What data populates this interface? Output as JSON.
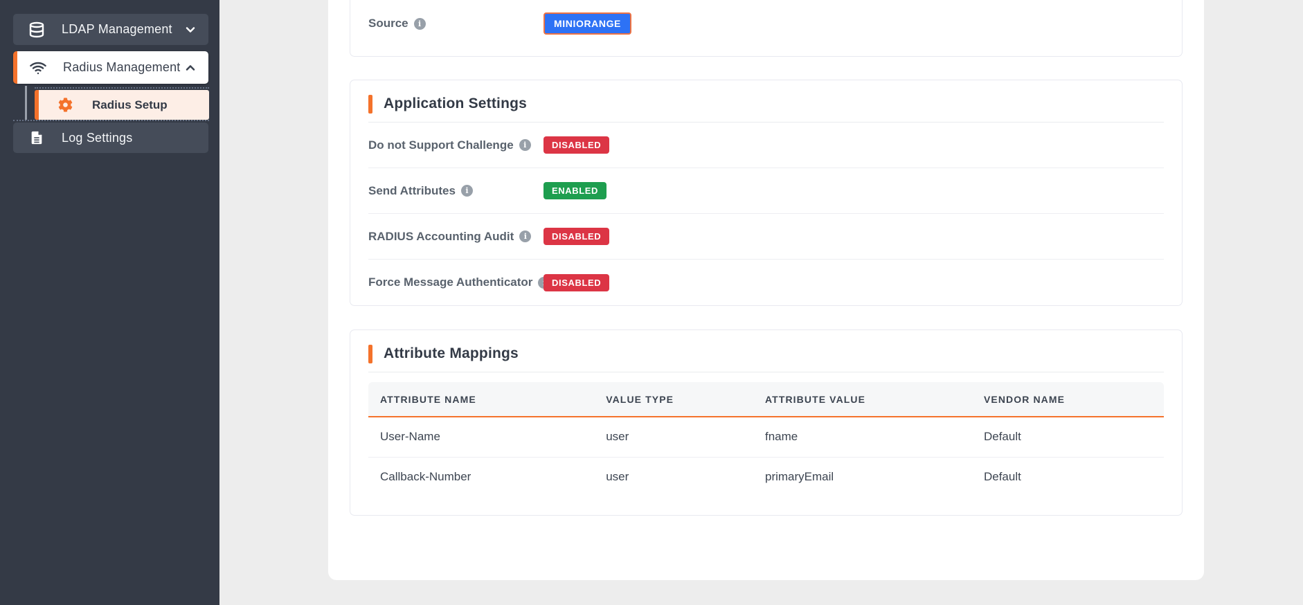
{
  "sidebar": {
    "items": [
      {
        "label": "LDAP Management",
        "icon": "database-icon",
        "chevron": "down"
      },
      {
        "label": "Radius Management",
        "icon": "wifi-icon",
        "chevron": "up"
      },
      {
        "label": "Radius Setup",
        "icon": "gear-icon"
      },
      {
        "label": "Log Settings",
        "icon": "file-icon"
      }
    ]
  },
  "source_card": {
    "label": "Source",
    "badge": "MINIORANGE"
  },
  "application_settings": {
    "title": "Application Settings",
    "rows": [
      {
        "label": "Do not Support Challenge",
        "status": "DISABLED"
      },
      {
        "label": "Send Attributes",
        "status": "ENABLED"
      },
      {
        "label": "RADIUS Accounting Audit",
        "status": "DISABLED"
      },
      {
        "label": "Force Message Authenticator",
        "status": "DISABLED"
      }
    ]
  },
  "attribute_mappings": {
    "title": "Attribute Mappings",
    "columns": [
      "ATTRIBUTE NAME",
      "VALUE TYPE",
      "ATTRIBUTE VALUE",
      "VENDOR NAME"
    ],
    "rows": [
      [
        "User-Name",
        "user",
        "fname",
        "Default"
      ],
      [
        "Callback-Number",
        "user",
        "primaryEmail",
        "Default"
      ]
    ]
  },
  "colors": {
    "accent_orange": "#f4722b",
    "badge_red": "#dc3545",
    "badge_green": "#1e9e4f",
    "badge_blue": "#2d72f5",
    "sidebar_bg": "#343a46",
    "sidebar_item_bg": "#454c59",
    "submenu_active_bg": "#fdeee6",
    "page_bg": "#ededed"
  }
}
